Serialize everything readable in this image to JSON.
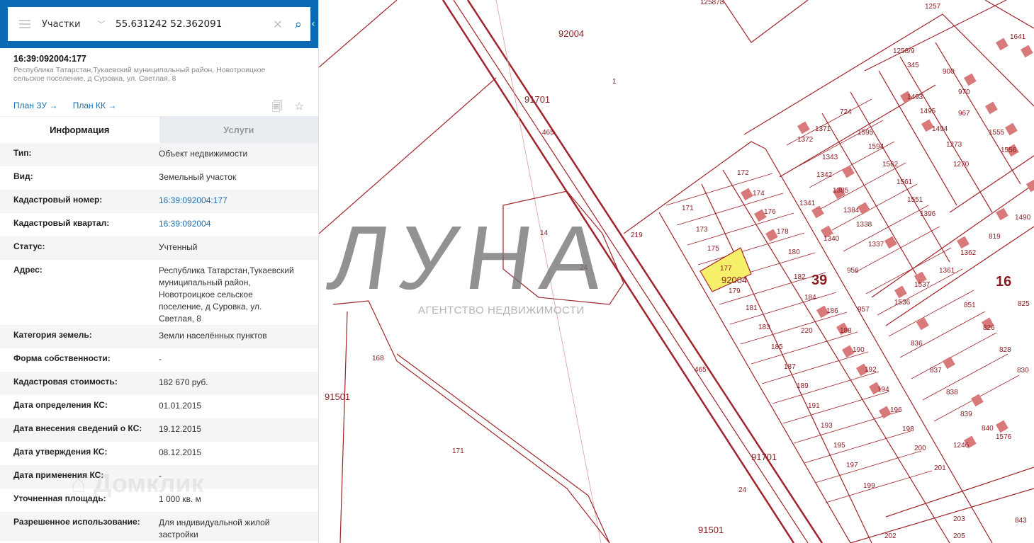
{
  "search": {
    "layer": "Участки",
    "query": "55.631242 52.362091"
  },
  "object": {
    "cadastral_number": "16:39:092004:177",
    "address": "Республика Татарстан,Тукаевский муниципальный район, Новотроицкое сельское поселение, д Суровка, ул. Светлая, 8",
    "plan_zu": "План ЗУ →",
    "plan_kk": "План КК →"
  },
  "tabs": [
    {
      "label": "Информация",
      "active": true
    },
    {
      "label": "Услуги",
      "active": false
    }
  ],
  "info": [
    {
      "k": "Тип:",
      "v": "Объект недвижимости"
    },
    {
      "k": "Вид:",
      "v": "Земельный участок"
    },
    {
      "k": "Кадастровый номер:",
      "v": "16:39:092004:177"
    },
    {
      "k": "Кадастровый квартал:",
      "v": "16:39:092004"
    },
    {
      "k": "Статус:",
      "v": "Учтенный"
    },
    {
      "k": "Адрес:",
      "v": "Республика Татарстан,Тукаевский муниципальный район, Новотроицкое сельское поселение, д Суровка, ул. Светлая, 8"
    },
    {
      "k": "Категория земель:",
      "v": "Земли населённых пунктов"
    },
    {
      "k": "Форма собственности:",
      "v": "-"
    },
    {
      "k": "Кадастровая стоимость:",
      "v": "182 670 руб."
    },
    {
      "k": "Дата определения КС:",
      "v": "01.01.2015"
    },
    {
      "k": "Дата внесения сведений о КС:",
      "v": "19.12.2015"
    },
    {
      "k": "Дата утверждения КС:",
      "v": "08.12.2015"
    },
    {
      "k": "Дата применения КС:",
      "v": "-"
    },
    {
      "k": "Уточненная площадь:",
      "v": "1 000 кв. м"
    },
    {
      "k": "Разрешенное использование:",
      "v": "Для индивидуальной жилой застройки"
    }
  ],
  "watermarks": {
    "domclick": "Домклик",
    "agency": "ЛУНА",
    "agency_sub": "АГЕНТСТВО НЕДВИЖИМОСТИ"
  },
  "map": {
    "labels": [
      "92004",
      "91701",
      "465",
      "1",
      "14",
      "24",
      "219",
      "171",
      "173",
      "175",
      "177",
      "92004",
      "179",
      "181",
      "183",
      "185",
      "187",
      "189",
      "191",
      "193",
      "195",
      "197",
      "199",
      "172",
      "174",
      "176",
      "178",
      "180",
      "182",
      "184",
      "186",
      "188",
      "190",
      "192",
      "194",
      "196",
      "198",
      "200",
      "201",
      "39",
      "16",
      "220",
      "1341",
      "1340",
      "956",
      "957",
      "91501",
      "91501",
      "168",
      "171",
      "91701",
      "465",
      "24",
      "724",
      "900",
      "970",
      "967",
      "345",
      "1257",
      "1258/9",
      "125878",
      "1641",
      "1372",
      "1371",
      "1343",
      "1342",
      "1385",
      "1384",
      "1338",
      "1337",
      "1595",
      "1594",
      "1562",
      "1561",
      "1551",
      "1396",
      "1495",
      "1493",
      "1494",
      "1273",
      "1270",
      "1555",
      "1556",
      "819",
      "1490",
      "1362",
      "1361",
      "1537",
      "1536",
      "851",
      "825",
      "826",
      "828",
      "830",
      "836",
      "837",
      "838",
      "839",
      "840",
      "1576",
      "1246",
      "203",
      "205",
      "202",
      "843"
    ],
    "selected_color": "#f5ef6a",
    "line_color": "#a0242a"
  },
  "colors": {
    "header": "#0a6ab4",
    "link": "#1e6fb0"
  }
}
